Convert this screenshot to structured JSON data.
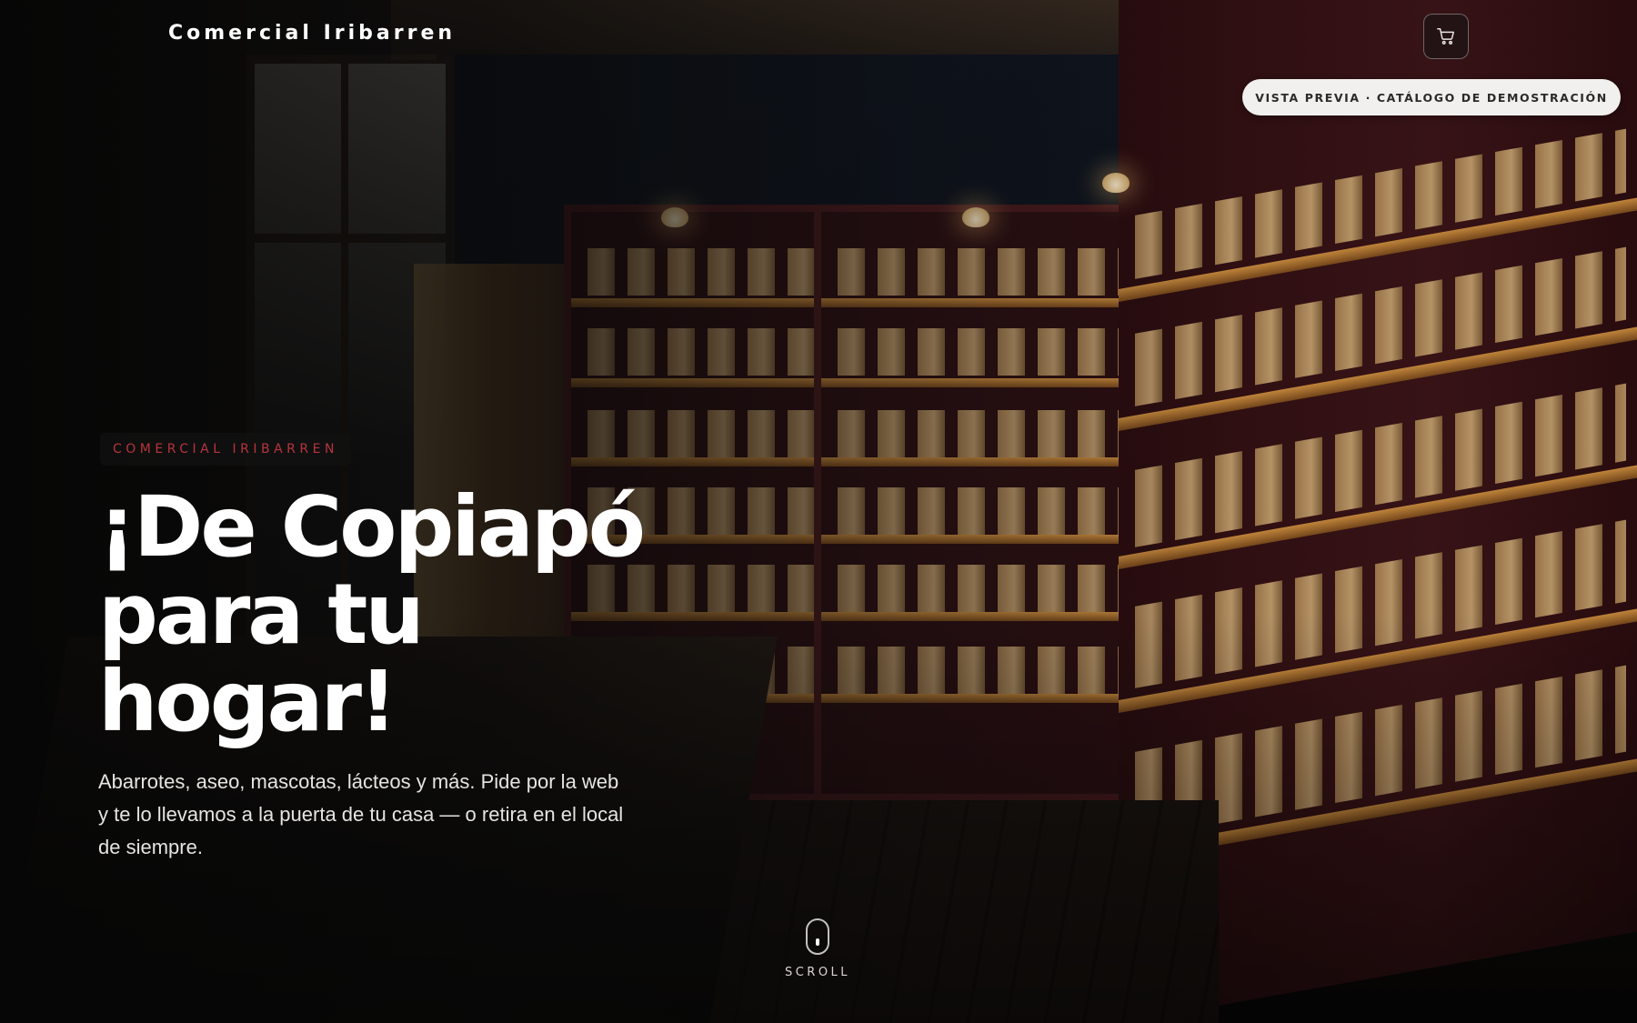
{
  "header": {
    "brand": "Comercial Iribarren",
    "cart_icon": "shopping-cart-icon",
    "preview_badge": "VISTA PREVIA · CATÁLOGO DE DEMOSTRACIÓN"
  },
  "hero": {
    "eyebrow": "COMERCIAL IRIBARREN",
    "headline_lines": [
      "¡De Copiapó",
      "para tu",
      "hogar!"
    ],
    "subtitle": "Abarrotes, aseo, mascotas, lácteos y más. Pide por la web y te lo llevamos a la puerta de tu casa — o retira en el local de siempre."
  },
  "scroll": {
    "label": "SCROLL",
    "icon": "mouse-scroll-icon"
  },
  "colors": {
    "accent": "#b8343c",
    "text": "#ffffff",
    "pill_bg": "#f1f0ee"
  }
}
